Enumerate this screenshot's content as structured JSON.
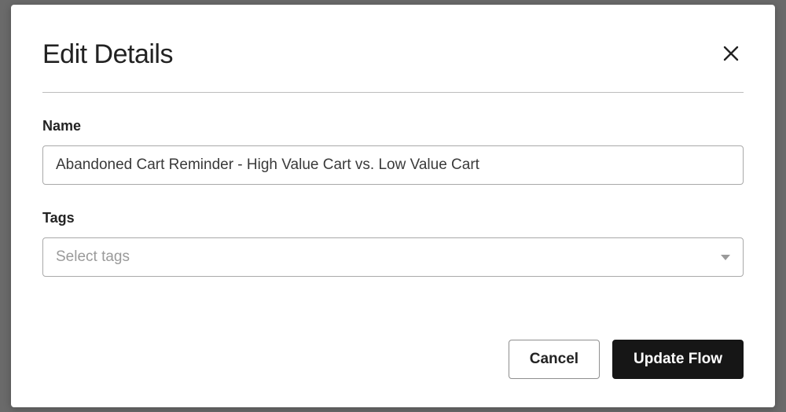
{
  "modal": {
    "title": "Edit Details",
    "close_icon": "close"
  },
  "fields": {
    "name": {
      "label": "Name",
      "value": "Abandoned Cart Reminder - High Value Cart vs. Low Value Cart"
    },
    "tags": {
      "label": "Tags",
      "placeholder": "Select tags"
    }
  },
  "actions": {
    "cancel": "Cancel",
    "submit": "Update Flow"
  }
}
